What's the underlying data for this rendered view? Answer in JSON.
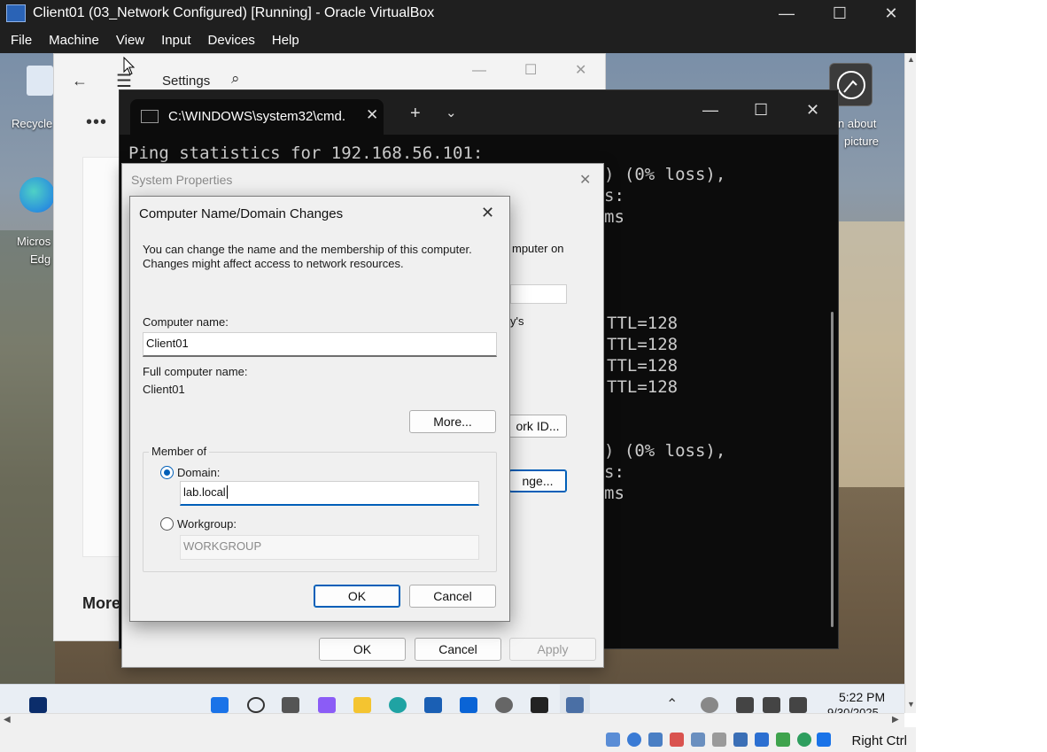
{
  "vbox": {
    "title": "Client01 (03_Network Configured) [Running] - Oracle VirtualBox",
    "menu": [
      "File",
      "Machine",
      "View",
      "Input",
      "Devices",
      "Help"
    ],
    "status_right": "Right Ctrl"
  },
  "desktop": {
    "recycle_label": "Recycle",
    "edge_label_1": "Micros",
    "edge_label_2": "Edg",
    "learn_label_1": "n about",
    "learn_label_2": "picture"
  },
  "settings": {
    "title": "Settings",
    "more_label": "More"
  },
  "cmd": {
    "tab_title": "C:\\WINDOWS\\system32\\cmd.",
    "lines_left": [
      "Ping statistics for 192.168.56.101:"
    ],
    "lines_right": [
      ") (0% loss),",
      "s:",
      "ms",
      "TTL=128",
      "TTL=128",
      "TTL=128",
      "TTL=128",
      ") (0% loss),",
      "s:",
      "ms"
    ]
  },
  "system_properties": {
    "title": "System Properties",
    "partial_text_1": "mputer on",
    "partial_text_2": "y's",
    "network_id_partial": "ork ID...",
    "change_partial": "nge...",
    "ok": "OK",
    "cancel": "Cancel",
    "apply": "Apply"
  },
  "dialog": {
    "title": "Computer Name/Domain Changes",
    "desc_line1": "You can change the name and the membership of this computer.",
    "desc_line2": "Changes might affect access to network resources.",
    "computer_name_label": "Computer name:",
    "computer_name_value": "Client01",
    "full_name_label": "Full computer name:",
    "full_name_value": "Client01",
    "more_button": "More...",
    "member_of_label": "Member of",
    "domain_label": "Domain:",
    "domain_value": "lab.local",
    "domain_selected": true,
    "workgroup_label": "Workgroup:",
    "workgroup_value": "WORKGROUP",
    "ok": "OK",
    "cancel": "Cancel"
  },
  "taskbar": {
    "time": "5:22 PM",
    "date_partial": "9/30/2025"
  }
}
